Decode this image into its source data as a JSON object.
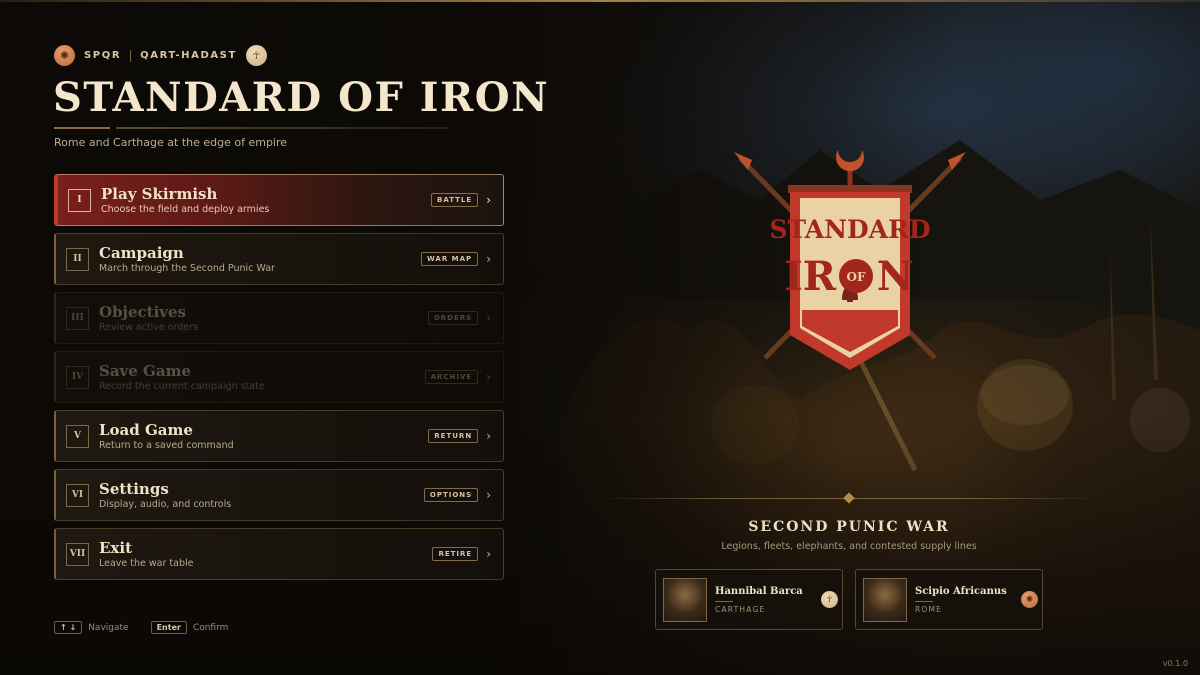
{
  "header": {
    "factions": [
      {
        "label": "SPQR",
        "seal_icon": "laurel-seal-icon"
      },
      {
        "label": "QART-HADAST",
        "seal_icon": "tanit-seal-icon"
      }
    ],
    "title": "STANDARD OF IRON",
    "subtitle": "Rome and Carthage at the edge of empire"
  },
  "menu": {
    "items": [
      {
        "numeral": "I",
        "label": "Play Skirmish",
        "desc": "Choose the field and deploy armies",
        "tag": "BATTLE",
        "state": "selected"
      },
      {
        "numeral": "II",
        "label": "Campaign",
        "desc": "March through the Second Punic War",
        "tag": "WAR MAP",
        "state": "normal"
      },
      {
        "numeral": "III",
        "label": "Objectives",
        "desc": "Review active orders",
        "tag": "ORDERS",
        "state": "disabled"
      },
      {
        "numeral": "IV",
        "label": "Save Game",
        "desc": "Record the current campaign state",
        "tag": "ARCHIVE",
        "state": "disabled"
      },
      {
        "numeral": "V",
        "label": "Load Game",
        "desc": "Return to a saved command",
        "tag": "RETURN",
        "state": "normal"
      },
      {
        "numeral": "VI",
        "label": "Settings",
        "desc": "Display, audio, and controls",
        "tag": "OPTIONS",
        "state": "normal"
      },
      {
        "numeral": "VII",
        "label": "Exit",
        "desc": "Leave the war table",
        "tag": "RETIRE",
        "state": "normal"
      }
    ]
  },
  "hints": {
    "navigate_key": "↑ ↓",
    "navigate_label": "Navigate",
    "confirm_key": "Enter",
    "confirm_label": "Confirm"
  },
  "emblem": {
    "line1": "STANDARD",
    "line2_left": "IR",
    "line2_mid": "OF",
    "line2_right": "N"
  },
  "war_panel": {
    "title": "SECOND PUNIC WAR",
    "subtitle": "Legions, fleets, elephants, and contested supply lines",
    "commanders": [
      {
        "name": "Hannibal Barca",
        "faction": "CARTHAGE",
        "seal_icon": "tanit-seal-icon"
      },
      {
        "name": "Scipio Africanus",
        "faction": "ROME",
        "seal_icon": "laurel-seal-icon"
      }
    ]
  },
  "version": "v0.1.0",
  "colors": {
    "accent_red": "#c2392a",
    "selected_bg": "#7a1f1b",
    "gold": "#b48c4a",
    "parchment": "#efe0c2"
  }
}
